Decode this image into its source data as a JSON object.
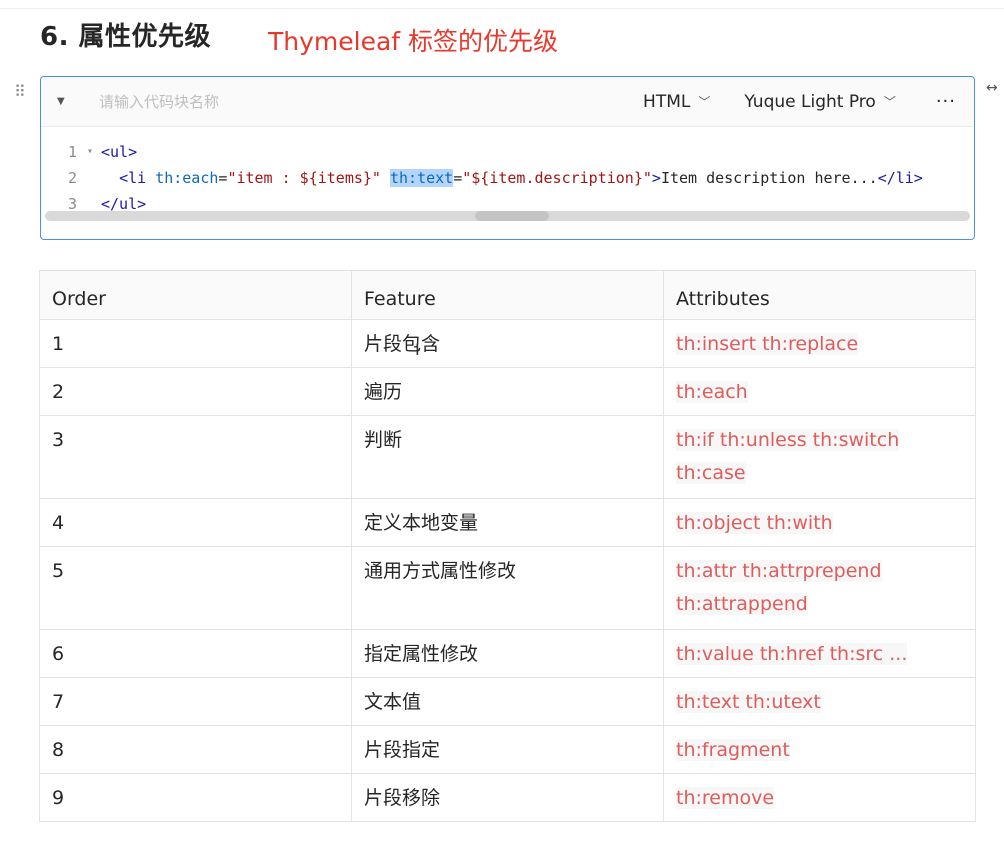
{
  "heading": "6. 属性优先级",
  "annotation": "Thymeleaf 标签的优先级",
  "code_block": {
    "name_placeholder": "请输入代码块名称",
    "language": "HTML",
    "theme": "Yuque Light Pro",
    "more": "···",
    "lines": [
      {
        "number": "1",
        "fold": "▾"
      },
      {
        "number": "2",
        "fold": ""
      },
      {
        "number": "3",
        "fold": ""
      }
    ],
    "line1": {
      "open_ul": "<ul>"
    },
    "line2": {
      "li_open": "<li",
      "each_attr": "th:each",
      "eq1": "=",
      "each_val": "\"item : ${items}\"",
      "text_attr": "th:text",
      "eq2": "=",
      "text_val": "\"${item.description}\"",
      "close_bracket": ">",
      "content": "Item description here...",
      "li_close": "</li>"
    },
    "line3": {
      "close_ul": "</ul>"
    }
  },
  "table": {
    "headers": [
      "Order",
      "Feature",
      "Attributes"
    ],
    "rows": [
      {
        "order": "1",
        "feature": "片段包含",
        "attrs": [
          "th:insert th:replace"
        ]
      },
      {
        "order": "2",
        "feature": "遍历",
        "attrs": [
          "th:each"
        ]
      },
      {
        "order": "3",
        "feature": "判断",
        "attrs": [
          "th:if th:unless th:switch",
          "th:case"
        ]
      },
      {
        "order": "4",
        "feature": "定义本地变量",
        "attrs": [
          "th:object th:with"
        ]
      },
      {
        "order": "5",
        "feature": "通用方式属性修改",
        "attrs": [
          "th:attr th:attrprepend",
          "th:attrappend"
        ]
      },
      {
        "order": "6",
        "feature": "指定属性修改",
        "attrs": [
          "th:value th:href th:src ..."
        ]
      },
      {
        "order": "7",
        "feature": "文本值",
        "attrs": [
          "th:text th:utext"
        ]
      },
      {
        "order": "8",
        "feature": "片段指定",
        "attrs": [
          "th:fragment"
        ]
      },
      {
        "order": "9",
        "feature": "片段移除",
        "attrs": [
          "th:remove"
        ]
      }
    ]
  },
  "icons": {
    "drag": "drag-handle-icon",
    "caret": "caret-down-icon",
    "chevron": "chevron-down-icon",
    "more": "more-icon",
    "expand": "expand-arrows-icon"
  },
  "colors": {
    "accent_red": "#e8382b",
    "code_border": "#4a90e2",
    "attr_text": "#e05c5c"
  }
}
